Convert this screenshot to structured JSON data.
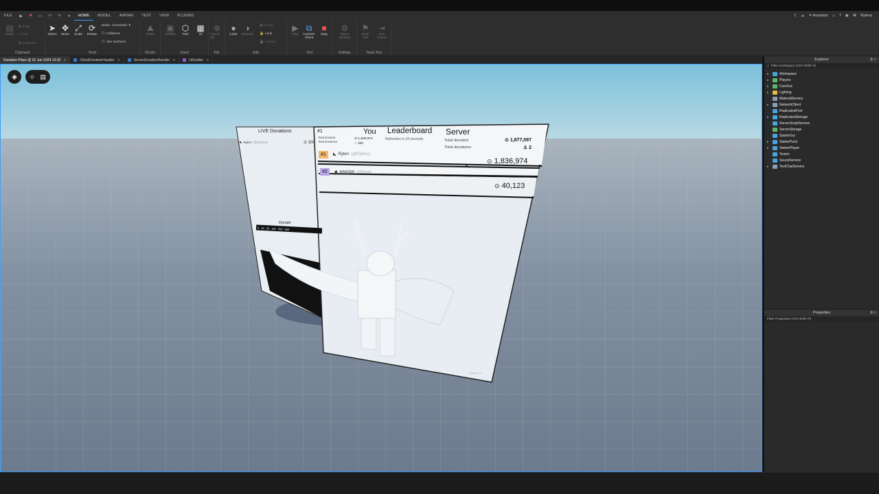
{
  "menubar": {
    "file": "FILE",
    "tabs": [
      "HOME",
      "MODEL",
      "AVATAR",
      "TEST",
      "VIEW",
      "PLUGINS"
    ],
    "assistant": "Assistant",
    "user": "Rylens"
  },
  "ribbon": {
    "clipboard": {
      "paste": "Paste",
      "copy": "Copy",
      "cut": "Cut",
      "duplicate": "Duplicate",
      "title": "Clipboard"
    },
    "tools": {
      "select": "Select",
      "move": "Move",
      "scale": "Scale",
      "rotate": "Rotate",
      "mode_label": "Mode:",
      "mode_value": "Geometric",
      "collisions": "Collisions",
      "join_surfaces": "Join Surfaces",
      "title": "Tools"
    },
    "terrain": {
      "editor": "Editor",
      "title": "Terrain"
    },
    "insert": {
      "toolbox": "Toolbox",
      "part": "Part",
      "ui": "UI",
      "title": "Insert"
    },
    "file": {
      "import3d": "Import 3D",
      "title": "File"
    },
    "edit": {
      "color": "Color",
      "material": "Material",
      "group": "Group",
      "lock": "Lock",
      "anchor": "Anchor",
      "title": "Edit"
    },
    "test": {
      "play": "Play",
      "current_client": "Current: Client",
      "stop": "Stop",
      "title": "Test"
    },
    "settings": {
      "game_settings": "Game Settings",
      "title": "Settings"
    },
    "team_test": {
      "team_test": "Team Test",
      "exit_game": "Exit Game",
      "title": "Team Test"
    }
  },
  "doctabs": [
    {
      "label": "Donation Place @ 01 Jun 2024 13:33",
      "active": true
    },
    {
      "label": "ClientDonationHandler",
      "active": false
    },
    {
      "label": "ServerDonationHandler",
      "active": false
    },
    {
      "label": "UIEmitter",
      "active": false
    }
  ],
  "board": {
    "live_title": "LIVE Donations",
    "live_entry_name": "Rylen",
    "live_entry_handle": "(@Rylens)",
    "live_entry_amount": "100",
    "donate_title": "Donate",
    "donate_amounts": [
      "5",
      "10",
      "25",
      "100",
      "250",
      "500"
    ],
    "rank_you": "#1",
    "you_label": "You",
    "you_total_donated_label": "Total donated",
    "you_total_donations_label": "Total donations",
    "you_total_donated": "1,836,974",
    "you_total_donations": "200",
    "leaderboard_title": "Leaderboard",
    "refresh_text": "Refreshes in 29 seconds.",
    "server_title": "Server",
    "server_total_donated_label": "Total donated",
    "server_total_donations_label": "Total donations",
    "server_total_donated": "1,877,097",
    "server_total_donations": "2",
    "rows": [
      {
        "rank": "#1",
        "name": "Rylen",
        "handle": "(@Rylens)",
        "amount": "1,836,974"
      },
      {
        "rank": "#2",
        "name": "RAIDER",
        "handle": "(@Raid)",
        "amount": "40,123"
      }
    ],
    "version": "Version 1.0"
  },
  "explorer": {
    "title": "Explorer",
    "filter": "Filter workspace (Ctrl+Shift+X)",
    "items": [
      {
        "label": "Workspace",
        "color": "#4aa3df",
        "expand": true
      },
      {
        "label": "Players",
        "color": "#5fb86a",
        "expand": true
      },
      {
        "label": "CoreGui",
        "color": "#5fb86a",
        "expand": true
      },
      {
        "label": "Lighting",
        "color": "#e0c040",
        "expand": true
      },
      {
        "label": "MaterialService",
        "color": "#8aa0b8",
        "expand": false
      },
      {
        "label": "NetworkClient",
        "color": "#8aa0b8",
        "expand": true
      },
      {
        "label": "ReplicatedFirst",
        "color": "#4aa3df",
        "expand": false
      },
      {
        "label": "ReplicatedStorage",
        "color": "#4aa3df",
        "expand": true
      },
      {
        "label": "ServerScriptService",
        "color": "#4aa3df",
        "expand": false
      },
      {
        "label": "ServerStorage",
        "color": "#5fb86a",
        "expand": false
      },
      {
        "label": "StarterGui",
        "color": "#4aa3df",
        "expand": false
      },
      {
        "label": "StarterPack",
        "color": "#4aa3df",
        "expand": true
      },
      {
        "label": "StarterPlayer",
        "color": "#4aa3df",
        "expand": true
      },
      {
        "label": "Teams",
        "color": "#4aa3df",
        "expand": false
      },
      {
        "label": "SoundService",
        "color": "#4aa3df",
        "expand": false
      },
      {
        "label": "TextChatService",
        "color": "#8aa0b8",
        "expand": true
      }
    ]
  },
  "properties": {
    "title": "Properties",
    "filter": "Filter Properties (Ctrl+Shift+P)"
  }
}
